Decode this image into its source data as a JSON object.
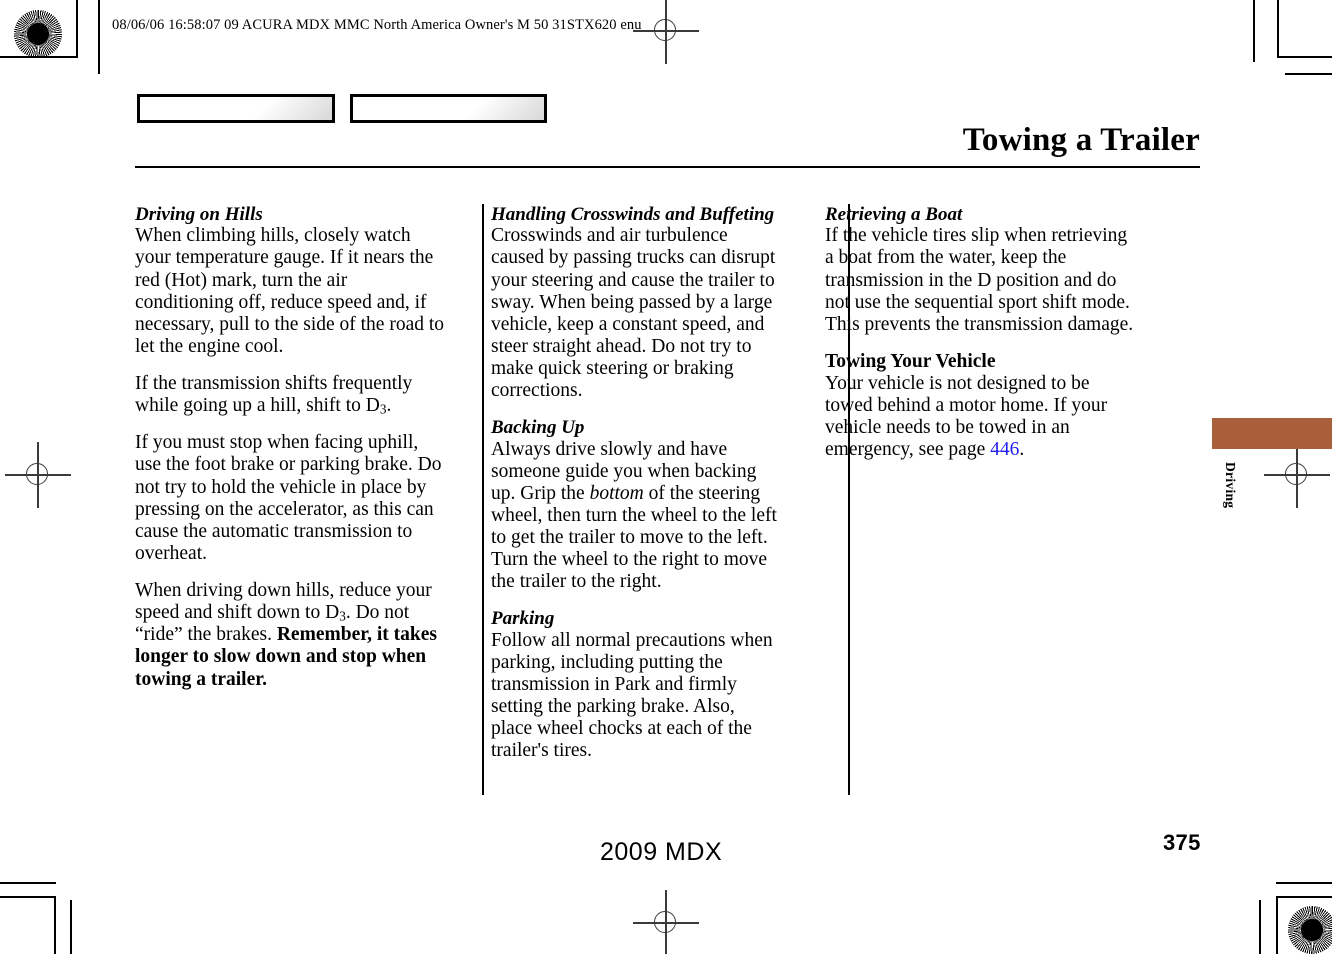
{
  "print_marks": {
    "imprint_line": "08/06/06 16:58:07    09 ACURA MDX MMC North America Owner's M 50 31STX620 enu",
    "starburst_icon": "starburst-registration-target",
    "crosshair_icon": "crosshair-registration-target"
  },
  "header": {
    "box_1_label": "",
    "box_2_label": "",
    "title": "Towing a Trailer"
  },
  "thumb_tab": {
    "label": "Driving",
    "color": "#a9603a"
  },
  "columns": [
    {
      "sections": [
        {
          "heading": "Driving on Hills",
          "heading_style": "bold-italic",
          "paragraphs": [
            "When climbing hills, closely watch your temperature gauge. If it nears the red (Hot) mark, turn the air conditioning off, reduce speed and, if necessary, pull to the side of the road to let the engine cool.",
            "If the transmission shifts frequently while going up a hill, shift to D3.",
            "If you must stop when facing uphill, use the foot brake or parking brake. Do not try to hold the vehicle in place by pressing on the accelerator, as this can cause the automatic transmission to overheat.",
            "When driving down hills, reduce your speed and shift down to D3. Do not “ride” the brakes. Remember, it takes longer to slow down and stop when towing a trailer."
          ]
        }
      ]
    },
    {
      "sections": [
        {
          "heading": "Handling Crosswinds and Buffeting",
          "heading_style": "bold-italic",
          "paragraphs": [
            "Crosswinds and air turbulence caused by passing trucks can disrupt your steering and cause the trailer to sway. When being passed by a large vehicle, keep a constant speed, and steer straight ahead. Do not try to make quick steering or braking corrections."
          ]
        },
        {
          "heading": "Backing Up",
          "heading_style": "bold-italic",
          "paragraphs": [
            "Always drive slowly and have someone guide you when backing up. Grip the bottom of the steering wheel, then turn the wheel to the left to get the trailer to move to the left. Turn the wheel to the right to move the trailer to the right."
          ]
        },
        {
          "heading": "Parking",
          "heading_style": "bold-italic",
          "paragraphs": [
            "Follow all normal precautions when parking, including putting the transmission in Park and firmly setting the parking brake. Also, place wheel chocks at each of the trailer's tires."
          ]
        }
      ]
    },
    {
      "sections": [
        {
          "heading": "Retrieving a Boat",
          "heading_style": "bold-italic",
          "paragraphs": [
            "If the vehicle tires slip when retrieving a boat from the water, keep the transmission in the D position and do not use the sequential sport shift mode. This prevents the transmission damage."
          ]
        },
        {
          "heading": "Towing Your Vehicle",
          "heading_style": "bold",
          "paragraphs": [
            "Your vehicle is not designed to be towed behind a motor home. If your vehicle needs to be towed in an emergency, see page 446."
          ]
        }
      ]
    }
  ],
  "inline": {
    "d3_letter": "D",
    "d3_sub": "3",
    "italic_bottom": "bottom",
    "bold_remember": "Remember, it takes longer to slow down and stop when towing a trailer.",
    "page_ref": "446"
  },
  "text_fragments": {
    "c1_p1": "When climbing hills, closely watch your temperature gauge. If it nears the red (Hot) mark, turn the air conditioning off, reduce speed and, if necessary, pull to the side of the road to let the engine cool.",
    "c1_p2_a": "If the transmission shifts frequently while going up a hill, shift to ",
    "c1_p2_b": ".",
    "c1_p3": "If you must stop when facing uphill, use the foot brake or parking brake. Do not try to hold the vehicle in place by pressing on the accelerator, as this can cause the automatic transmission to overheat.",
    "c1_p4_a": "When driving down hills, reduce your speed and shift down to ",
    "c1_p4_b": ". Do not “ride” the brakes. ",
    "c2_p1": "Crosswinds and air turbulence caused by passing trucks can disrupt your steering and cause the trailer to sway. When being passed by a large vehicle, keep a constant speed, and steer straight ahead. Do not try to make quick steering or braking corrections.",
    "c2_p2_a": "Always drive slowly and have someone guide you when backing up. Grip the ",
    "c2_p2_b": " of the steering wheel, then turn the wheel to the left to get the trailer to move to the left. Turn the wheel to the right to move the trailer to the right.",
    "c2_p3": "Follow all normal precautions when parking, including putting the transmission in Park and firmly setting the parking brake. Also, place wheel chocks at each of the trailer's tires.",
    "c3_p1": "If the vehicle tires slip when retrieving a boat from the water, keep the transmission in the D position and do not use the sequential sport shift mode. This prevents the transmission damage.",
    "c3_p2_a": "Your vehicle is not designed to be towed behind a motor home. If your vehicle needs to be towed in an emergency, see page ",
    "c3_p2_b": "."
  },
  "footer": {
    "model_year": "2009  MDX",
    "page_number": "375"
  }
}
